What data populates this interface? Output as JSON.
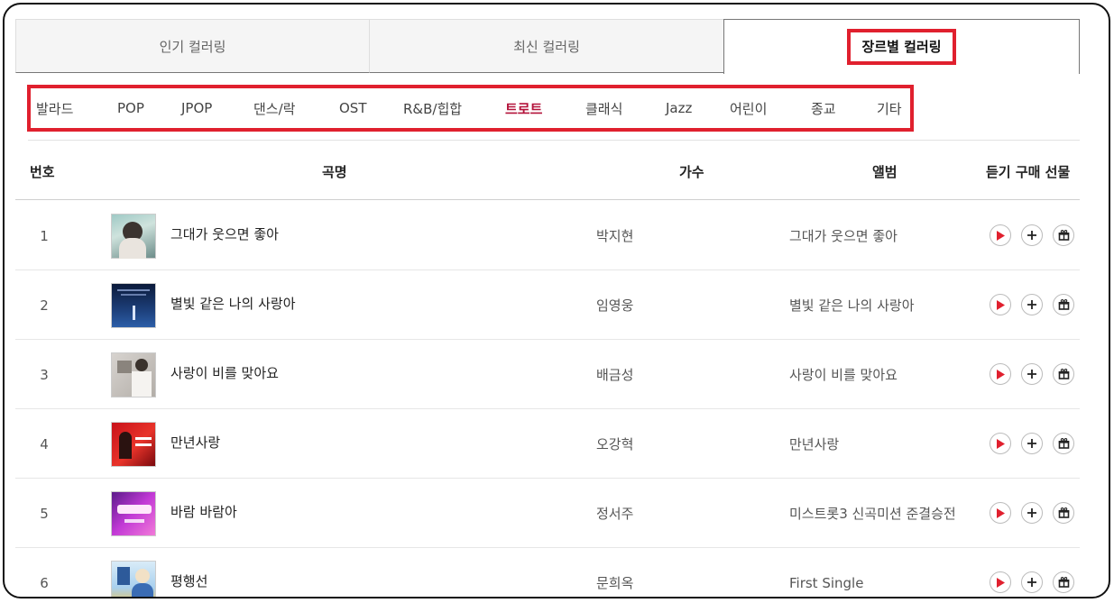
{
  "tabs": [
    {
      "label": "인기 컬러링"
    },
    {
      "label": "최신 컬러링"
    },
    {
      "label": "장르별 컬러링"
    }
  ],
  "genres": [
    {
      "label": "발라드"
    },
    {
      "label": "POP"
    },
    {
      "label": "JPOP"
    },
    {
      "label": "댄스/락"
    },
    {
      "label": "OST"
    },
    {
      "label": "R&B/힙합"
    },
    {
      "label": "트로트"
    },
    {
      "label": "클래식"
    },
    {
      "label": "Jazz"
    },
    {
      "label": "어린이"
    },
    {
      "label": "종교"
    },
    {
      "label": "기타"
    }
  ],
  "active_genre": "트로트",
  "table": {
    "headers": {
      "number": "번호",
      "title": "곡명",
      "artist": "가수",
      "album": "앨범",
      "actions": "듣기 구매 선물"
    },
    "rows": [
      {
        "num": "1",
        "title": "그대가 웃으면 좋아",
        "artist": "박지현",
        "album": "그대가 웃으면 좋아"
      },
      {
        "num": "2",
        "title": "별빛 같은 나의 사랑아",
        "artist": "임영웅",
        "album": "별빛 같은 나의 사랑아"
      },
      {
        "num": "3",
        "title": "사랑이 비를 맞아요",
        "artist": "배금성",
        "album": "사랑이 비를 맞아요"
      },
      {
        "num": "4",
        "title": "만년사랑",
        "artist": "오강혁",
        "album": "만년사랑"
      },
      {
        "num": "5",
        "title": "바람 바람아",
        "artist": "정서주",
        "album": "미스트롯3 신곡미션 준결승전"
      },
      {
        "num": "6",
        "title": "평행선",
        "artist": "문희옥",
        "album": "First Single"
      }
    ]
  },
  "icons": {
    "play": "play-icon",
    "buy": "plus-icon",
    "gift": "gift-icon"
  },
  "colors": {
    "highlight_border": "#e0202e",
    "active_genre": "#b3123a",
    "play_icon": "#e0202e"
  }
}
